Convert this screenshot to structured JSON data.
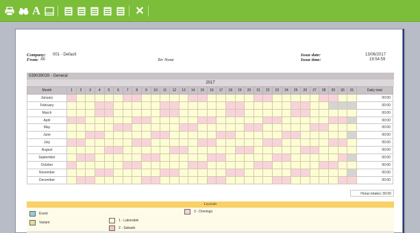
{
  "toolbar": {
    "icons": [
      "print-icon",
      "binoculars-icon",
      "text-icon",
      "page-icon",
      "export-pdf-icon",
      "export-excel-icon",
      "export-word-icon",
      "export-html-icon",
      "export-csv-icon",
      "close-icon"
    ],
    "text_label": "A",
    "close_label": "✕"
  },
  "header": {
    "company_label": "Company:",
    "company_value": "001 - Default",
    "from_label": "From:",
    "from_value": "All",
    "center_text": "Ter None",
    "issue_date_label": "Issue date:",
    "issue_date_value": "13/06/2017",
    "issue_time_label": "Issue time:",
    "issue_time_value": "19:54:59"
  },
  "report": {
    "shift_title": "039039039 - General",
    "year": "2017",
    "month_header": "Month",
    "total_header": "Daily total",
    "days": [
      "1",
      "2",
      "3",
      "4",
      "5",
      "6",
      "7",
      "8",
      "9",
      "10",
      "11",
      "12",
      "13",
      "14",
      "15",
      "16",
      "17",
      "18",
      "19",
      "20",
      "21",
      "22",
      "23",
      "24",
      "25",
      "26",
      "27",
      "28",
      "29",
      "30",
      "31"
    ],
    "months": [
      {
        "name": "January",
        "total": "00:00"
      },
      {
        "name": "February",
        "total": "00:00"
      },
      {
        "name": "March",
        "total": "00:00"
      },
      {
        "name": "April",
        "total": "00:00"
      },
      {
        "name": "May",
        "total": "00:00"
      },
      {
        "name": "June",
        "total": "00:00"
      },
      {
        "name": "July",
        "total": "00:00"
      },
      {
        "name": "August",
        "total": "00:00"
      },
      {
        "name": "September",
        "total": "00:00"
      },
      {
        "name": "October",
        "total": "00:00"
      },
      {
        "name": "November",
        "total": "00:00"
      },
      {
        "name": "December",
        "total": "00:00"
      }
    ],
    "grand_total": "Horas totales: 00:00"
  },
  "legend": {
    "title": "Leyenda",
    "items": [
      {
        "label": "Event",
        "color": "#8fd0de"
      },
      {
        "label": "Variant",
        "color": "#e3dca0"
      },
      {
        "label": "1 - Laborable",
        "color": "#fdfdd5"
      },
      {
        "label": "2 - Sabado",
        "color": "#f3c9b6"
      },
      {
        "label": "3 - Domingo",
        "color": "#f8d3dc"
      }
    ]
  },
  "colors": {
    "toolbar": "#7cbd3a",
    "weekday": "#fdfdd5",
    "weekend": "#f8d3dc",
    "invalid_day": "#d4d4d4",
    "legend_bar": "#f9cf68"
  }
}
